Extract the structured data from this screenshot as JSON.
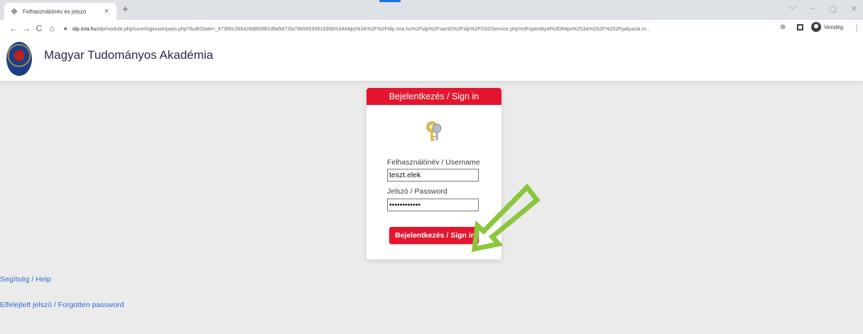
{
  "browser": {
    "tab_title": "Felhasználónév és jelszó",
    "tab_close": "×",
    "new_tab": "+",
    "window_controls": [
      "﹀",
      "–",
      "▢",
      "✕"
    ],
    "url_host": "idp.mta.hu",
    "url_path": "/idp/module.php/core/loginuserpass.php?AuthState=_87360c266428d805f82d9a5d72fa7865653391830b%3Ahttps%3A%2F%2Fidp.mta.hu%2Fidp%2Fsaml2%2Fidp%2FSSOService.php%3Fspentityid%3Dhttps%253A%252F%252Fpalyazat.m...",
    "profile_label": "Vendég",
    "icons": {
      "back": "back-arrow-icon",
      "forward": "forward-arrow-icon",
      "reload": "reload-icon",
      "home": "home-icon",
      "lock": "lock-icon",
      "zoom": "zoom-icon",
      "menu": "kebab-menu-icon"
    }
  },
  "site": {
    "title": "Magyar Tudományos Akadémia"
  },
  "login": {
    "header": "Bejelentkezés / Sign in",
    "username_label": "Felhasználónév / Username",
    "username_value": "teszt.elek",
    "password_label": "Jelszó / Password",
    "password_value": "••••••••••••",
    "submit_label": "Bejelentkezés / Sign in",
    "help_link": "Segítség / Help",
    "forgot_link": "Elfelejtett jelszó / Forgotten password"
  },
  "colors": {
    "accent_red": "#e4162f",
    "annotation_green": "#8cc63f",
    "link_blue": "#2f6bd0"
  }
}
